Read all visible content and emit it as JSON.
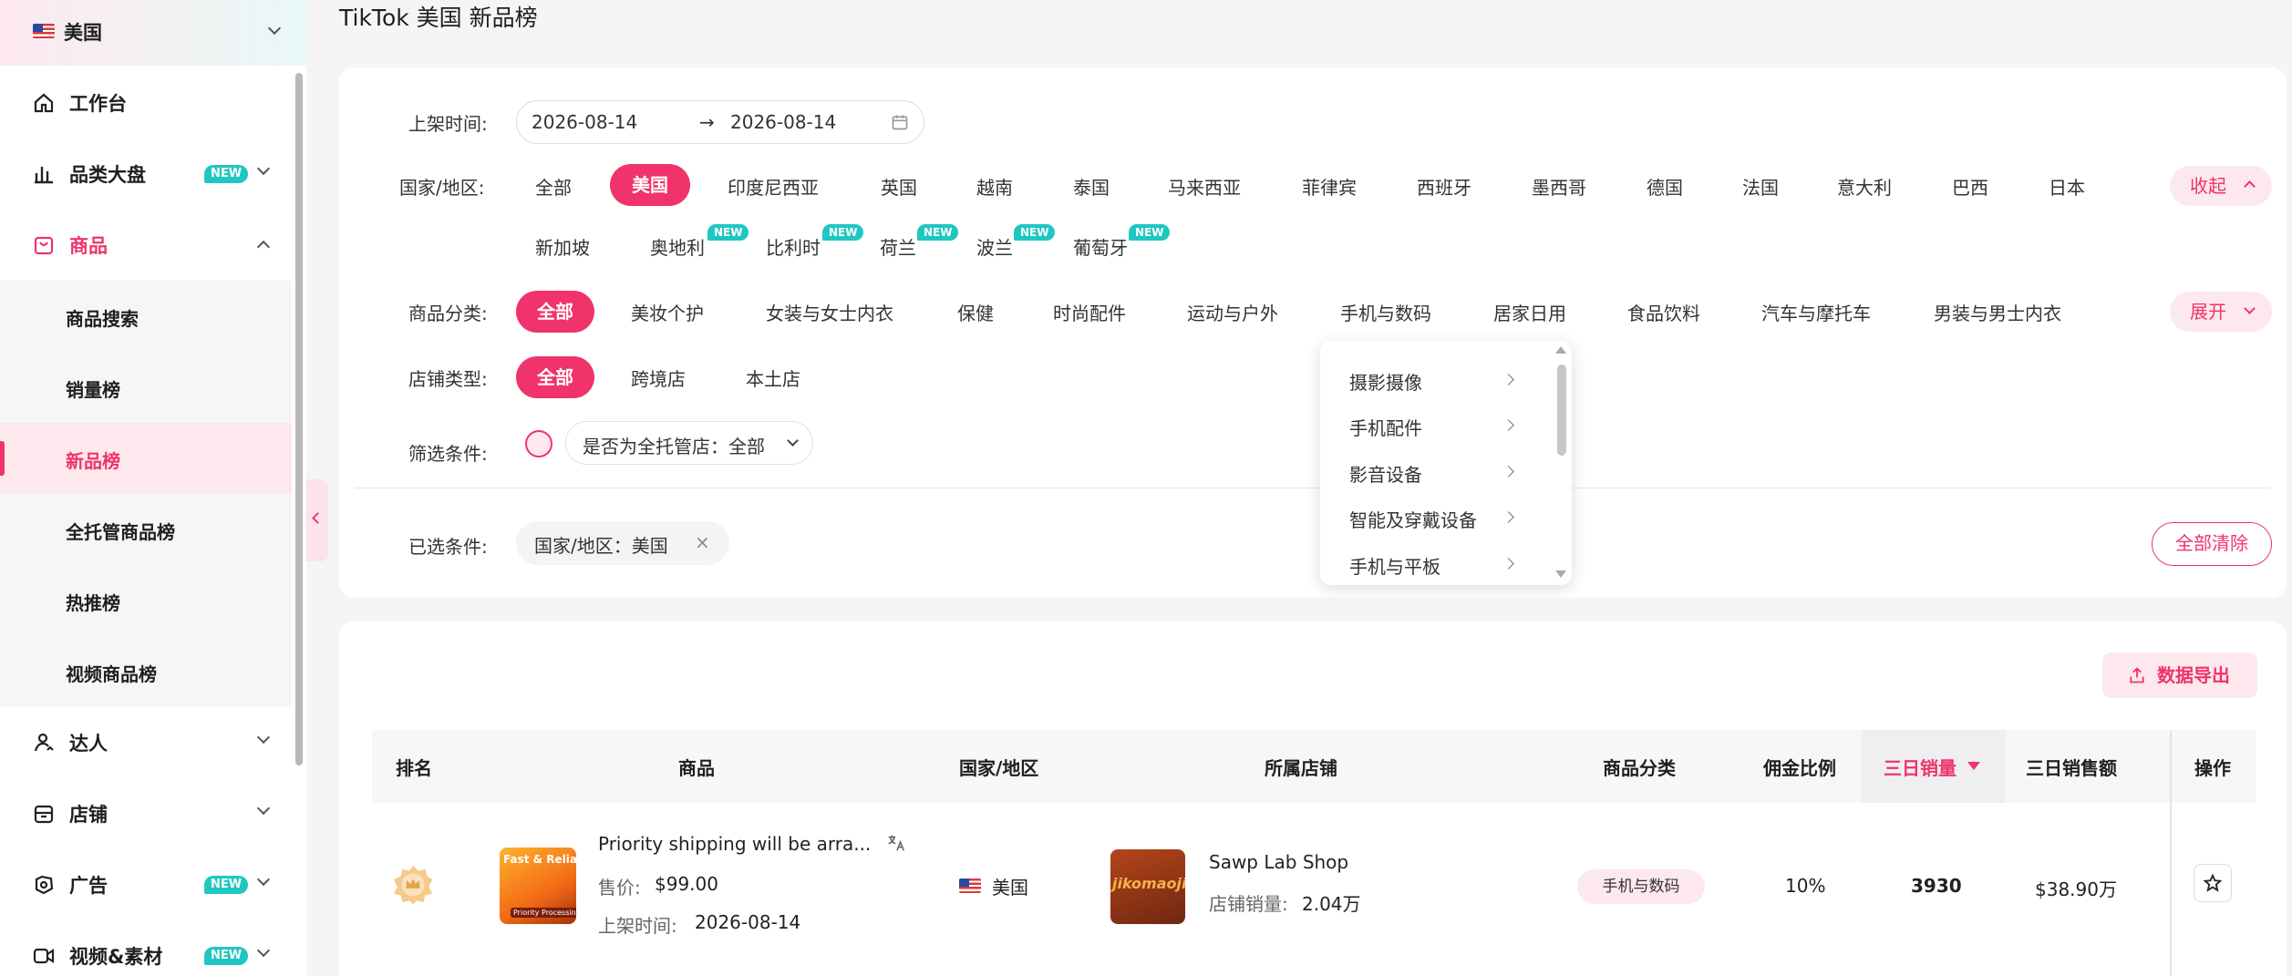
{
  "sidebar": {
    "region": "美国",
    "items": [
      {
        "label": "工作台",
        "icon": "home-icon"
      },
      {
        "label": "品类大盘",
        "icon": "bar-chart-icon",
        "badge": "NEW"
      },
      {
        "label": "商品",
        "icon": "shopping-bag-icon"
      },
      {
        "label": "达人",
        "icon": "person-icon"
      },
      {
        "label": "店铺",
        "icon": "store-icon"
      },
      {
        "label": "广告",
        "icon": "ad-icon",
        "badge": "NEW"
      },
      {
        "label": "视频&素材",
        "icon": "video-icon",
        "badge": "NEW"
      }
    ],
    "product_sub": [
      "商品搜索",
      "销量榜",
      "新品榜",
      "全托管商品榜",
      "热推榜",
      "视频商品榜"
    ]
  },
  "page_title": "TikTok 美国 新品榜",
  "filters": {
    "listing_time_label": "上架时间:",
    "date_start": "2026-08-14",
    "date_sep": "→",
    "date_end": "2026-08-14",
    "country_label": "国家/地区:",
    "countries_row1": [
      "全部",
      "美国",
      "印度尼西亚",
      "英国",
      "越南",
      "泰国",
      "马来西亚",
      "菲律宾",
      "西班牙",
      "墨西哥",
      "德国",
      "法国",
      "意大利",
      "巴西",
      "日本"
    ],
    "countries_row2": [
      "新加坡",
      "奥地利",
      "比利时",
      "荷兰",
      "波兰",
      "葡萄牙"
    ],
    "new_badge": "NEW",
    "collapse_label": "收起",
    "category_label": "商品分类:",
    "categories": [
      "全部",
      "美妆个护",
      "女装与女士内衣",
      "保健",
      "时尚配件",
      "运动与户外",
      "手机与数码",
      "居家日用",
      "食品饮料",
      "汽车与摩托车",
      "男装与男士内衣"
    ],
    "expand_label": "展开",
    "store_type_label": "店铺类型:",
    "store_types": [
      "全部",
      "跨境店",
      "本土店"
    ],
    "condition_label": "筛选条件:",
    "trust_select": "是否为全托管店：全部",
    "selected_label": "已选条件:",
    "selected_chip": "国家/地区：美国",
    "clear_all": "全部清除"
  },
  "dropdown": [
    "摄影摄像",
    "手机配件",
    "影音设备",
    "智能及穿戴设备",
    "手机与平板"
  ],
  "table": {
    "export_label": "数据导出",
    "headers": [
      "排名",
      "商品",
      "国家/地区",
      "所属店铺",
      "商品分类",
      "佣金比例",
      "三日销量",
      "三日销售额",
      "操作"
    ],
    "rows": [
      {
        "product_title": "Priority shipping will be arra...",
        "price_label": "售价:",
        "price": "$99.00",
        "listing_label": "上架时间:",
        "listing_date": "2026-08-14",
        "thumb_text": "Fast & Reliable",
        "thumb_sub": "Priority Processing",
        "country": "美国",
        "shop_name": "Sawp Lab Shop",
        "shop_thumb_text": "jikomaoji",
        "shop_sales_label": "店铺销量:",
        "shop_sales": "2.04万",
        "category": "手机与数码",
        "commission": "10%",
        "sales_3d": "3930",
        "revenue_3d": "$38.90万"
      }
    ]
  },
  "colors": {
    "accent": "#f0336a",
    "badge": "#1fc7c2",
    "accent_light": "#fde8ee"
  }
}
